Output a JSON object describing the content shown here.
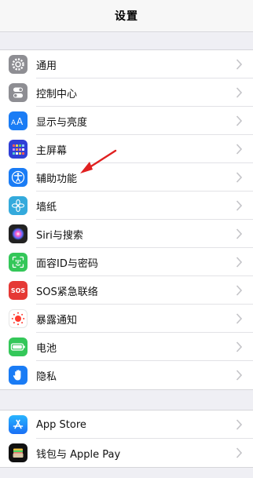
{
  "header": {
    "title": "设置"
  },
  "groups": [
    {
      "items": [
        {
          "label": "通用",
          "icon": "gear-icon",
          "color": "#8e8e93"
        },
        {
          "label": "控制中心",
          "icon": "toggles-icon",
          "color": "#8e8e93"
        },
        {
          "label": "显示与亮度",
          "icon": "text-size-icon",
          "color": "#1a7cf5"
        },
        {
          "label": "主屏幕",
          "icon": "app-grid-icon",
          "color": "#2f3fd6"
        },
        {
          "label": "辅助功能",
          "icon": "accessibility-icon",
          "color": "#1a7cf5"
        },
        {
          "label": "墙纸",
          "icon": "flower-icon",
          "color": "#34aadc"
        },
        {
          "label": "Siri与搜索",
          "icon": "siri-icon",
          "color": "#222222"
        },
        {
          "label": "面容ID与密码",
          "icon": "face-id-icon",
          "color": "#34c759"
        },
        {
          "label": "SOS紧急联络",
          "icon": "sos-icon",
          "color": "#e53935",
          "icon_text": "SOS"
        },
        {
          "label": "暴露通知",
          "icon": "exposure-icon",
          "color": "#ffffff"
        },
        {
          "label": "电池",
          "icon": "battery-icon",
          "color": "#34c759"
        },
        {
          "label": "隐私",
          "icon": "hand-icon",
          "color": "#1a7cf5"
        }
      ]
    },
    {
      "items": [
        {
          "label": "App Store",
          "icon": "app-store-icon",
          "color": "#1a8cf5"
        },
        {
          "label": "钱包与 Apple Pay",
          "icon": "wallet-icon",
          "color": "#111111"
        }
      ]
    }
  ],
  "annotation": {
    "color": "#e02020",
    "points_to": "辅助功能"
  }
}
